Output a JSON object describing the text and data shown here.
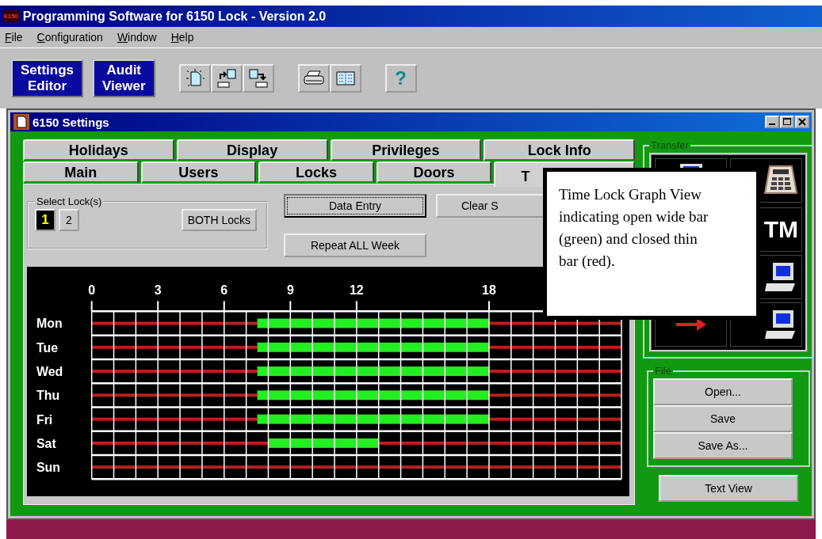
{
  "app": {
    "logo": "6150",
    "title": "Programming Software for 6150 Lock - Version 2.0"
  },
  "menu": [
    "File",
    "Configuration",
    "Window",
    "Help"
  ],
  "mode_buttons": [
    {
      "lines": [
        "Settings",
        "Editor"
      ]
    },
    {
      "lines": [
        "Audit",
        "Viewer"
      ]
    }
  ],
  "icon_groups": [
    [
      {
        "kind": "new"
      },
      {
        "kind": "send"
      },
      {
        "kind": "receive"
      }
    ],
    [
      {
        "kind": "print"
      },
      {
        "kind": "grid"
      }
    ],
    [
      {
        "kind": "help",
        "label": "?"
      }
    ]
  ],
  "child_window": {
    "title": "6150 Settings"
  },
  "tabs": {
    "back_row": [
      {
        "label": "Holidays",
        "selected": false
      },
      {
        "label": "Display",
        "selected": false
      },
      {
        "label": "Privileges",
        "selected": false
      },
      {
        "label": "Lock Info",
        "selected": false
      }
    ],
    "front_row": [
      {
        "label": "Main",
        "selected": false
      },
      {
        "label": "Users",
        "selected": false
      },
      {
        "label": "Locks",
        "selected": false
      },
      {
        "label": "Doors",
        "selected": false
      },
      {
        "label": "T",
        "selected": true
      }
    ]
  },
  "select_locks": {
    "legend": "Select Lock(s)",
    "buttons": [
      {
        "label": "1",
        "selected": true
      },
      {
        "label": "2",
        "selected": false
      },
      {
        "label": "BOTH Locks",
        "selected": false
      }
    ]
  },
  "actions": [
    {
      "label": "Data Entry",
      "focused": true
    },
    {
      "label": "Repeat ALL Week",
      "focused": false
    },
    {
      "label": "Clear S",
      "focused": false
    }
  ],
  "graph": {
    "chart_data": {
      "type": "bar",
      "orientation": "horizontal",
      "stacked": true,
      "categories": [
        "Mon",
        "Tue",
        "Wed",
        "Thu",
        "Fri",
        "Sat",
        "Sun"
      ],
      "xlim": [
        0,
        24
      ],
      "xticks": [
        0,
        3,
        6,
        9,
        12,
        18
      ],
      "grid": true,
      "series": [
        {
          "color": "#b82020",
          "values": [
            7.5,
            7.5,
            7.5,
            7.5,
            7.5,
            8,
            24
          ]
        },
        {
          "color": "#22ee22",
          "values": [
            10.5,
            10.5,
            10.5,
            10.5,
            10.5,
            5,
            0
          ]
        },
        {
          "color": "#b82020",
          "values": [
            6,
            6,
            6,
            6,
            6,
            11,
            0
          ]
        }
      ]
    }
  },
  "transfer": {
    "legend": "Transfer",
    "tm_label": "TM"
  },
  "file": {
    "legend": "File",
    "buttons": [
      "Open...",
      "Save",
      "Save As..."
    ]
  },
  "text_view_button": "Text View",
  "callout": "Time Lock Graph View indicating open wide bar (green) and closed thin bar (red)."
}
